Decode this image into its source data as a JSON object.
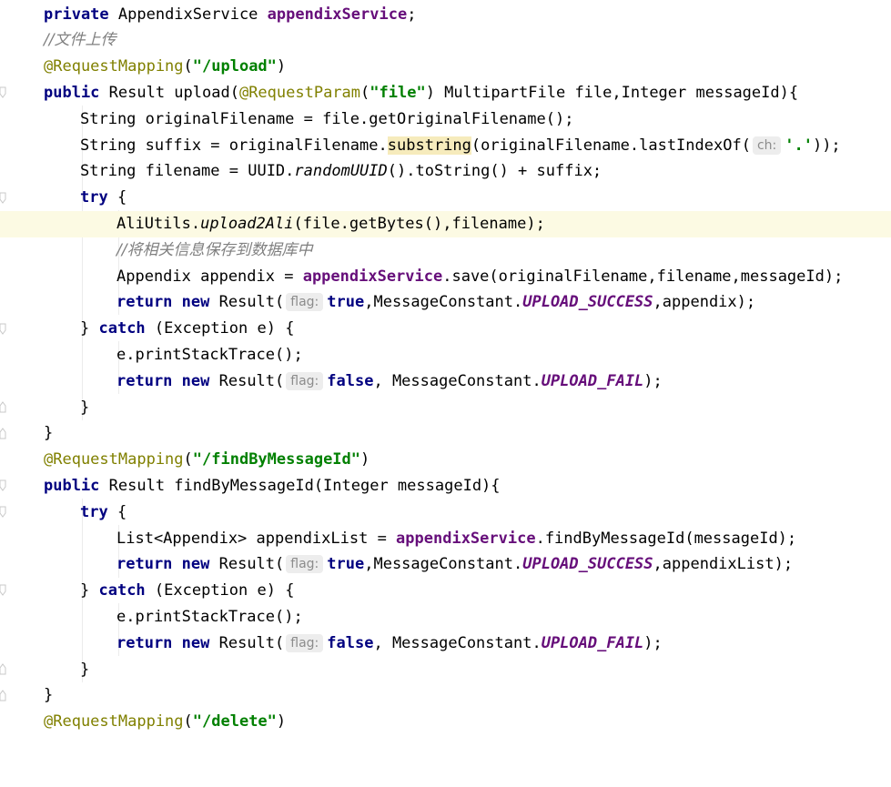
{
  "code": {
    "l1": {
      "a": "private ",
      "b": "AppendixService ",
      "c": "appendixService",
      "d": ";"
    },
    "l2": {
      "comment": "//文件上传"
    },
    "l3": {
      "ann": "@RequestMapping",
      "p1": "(",
      "str": "\"/upload\"",
      "p2": ")"
    },
    "l4": {
      "kw": "public ",
      "a": "Result upload(",
      "ann": "@RequestParam",
      "b": "(",
      "str": "\"file\"",
      "c": ") MultipartFile file,Integer messageId){"
    },
    "l5": {
      "a": "String originalFilename = file.getOriginalFilename();"
    },
    "l6": {
      "a": "String suffix = originalFilename.",
      "warn": "substring",
      "b": "(originalFilename.lastIndexOf(",
      "hint": "ch:",
      "str": "'.'",
      "c": "));"
    },
    "l7": {
      "a": "String filename = UUID.",
      "static": "randomUUID",
      "b": "().toString() + suffix;"
    },
    "l8": {
      "kw": "try ",
      "a": "{"
    },
    "l9": {
      "a": "AliUtils.",
      "static": "upload2Ali",
      "b": "(file.getBytes(),filename);"
    },
    "l10": {
      "comment": "//将相关信息保存到数据库中"
    },
    "l11": {
      "a": "Appendix appendix = ",
      "fld": "appendixService",
      "b": ".save(originalFilename,filename,messageId);"
    },
    "l12": {
      "kw1": "return ",
      "kw2": "new ",
      "a": "Result(",
      "hint": "flag:",
      "kw3": "true",
      "b": ",MessageConstant.",
      "const": "UPLOAD_SUCCESS",
      "c": ",appendix);"
    },
    "l13": {
      "a": "} ",
      "kw": "catch ",
      "b": "(Exception e) {"
    },
    "l14": {
      "a": "e.printStackTrace();"
    },
    "l15": {
      "kw1": "return ",
      "kw2": "new ",
      "a": "Result(",
      "hint": "flag:",
      "kw3": "false",
      "b": ", MessageConstant.",
      "const": "UPLOAD_FAIL",
      "c": ");"
    },
    "l16": {
      "a": "}"
    },
    "l17": {
      "a": "}"
    },
    "l18": {
      "ann": "@RequestMapping",
      "p1": "(",
      "str": "\"/findByMessageId\"",
      "p2": ")"
    },
    "l19": {
      "kw": "public ",
      "a": "Result findByMessageId(Integer messageId){"
    },
    "l20": {
      "kw": "try ",
      "a": "{"
    },
    "l21": {
      "a": "List<Appendix> appendixList = ",
      "fld": "appendixService",
      "b": ".findByMessageId(messageId);"
    },
    "l22": {
      "kw1": "return ",
      "kw2": "new ",
      "a": "Result(",
      "hint": "flag:",
      "kw3": "true",
      "b": ",MessageConstant.",
      "const": "UPLOAD_SUCCESS",
      "c": ",appendixList);"
    },
    "l23": {
      "a": "} ",
      "kw": "catch ",
      "b": "(Exception e) {"
    },
    "l24": {
      "a": "e.printStackTrace();"
    },
    "l25": {
      "kw1": "return ",
      "kw2": "new ",
      "a": "Result(",
      "hint": "flag:",
      "kw3": "false",
      "b": ", MessageConstant.",
      "const": "UPLOAD_FAIL",
      "c": ");"
    },
    "l26": {
      "a": "}"
    },
    "l27": {
      "a": "}"
    },
    "l28": {
      "ann": "@RequestMapping",
      "p1": "(",
      "str": "\"/delete\"",
      "p2": ")"
    }
  },
  "colors": {
    "keyword": "#000080",
    "field": "#660e7a",
    "string": "#008000",
    "annotation": "#808000",
    "comment": "#808080",
    "current_line": "#fcfae3"
  }
}
